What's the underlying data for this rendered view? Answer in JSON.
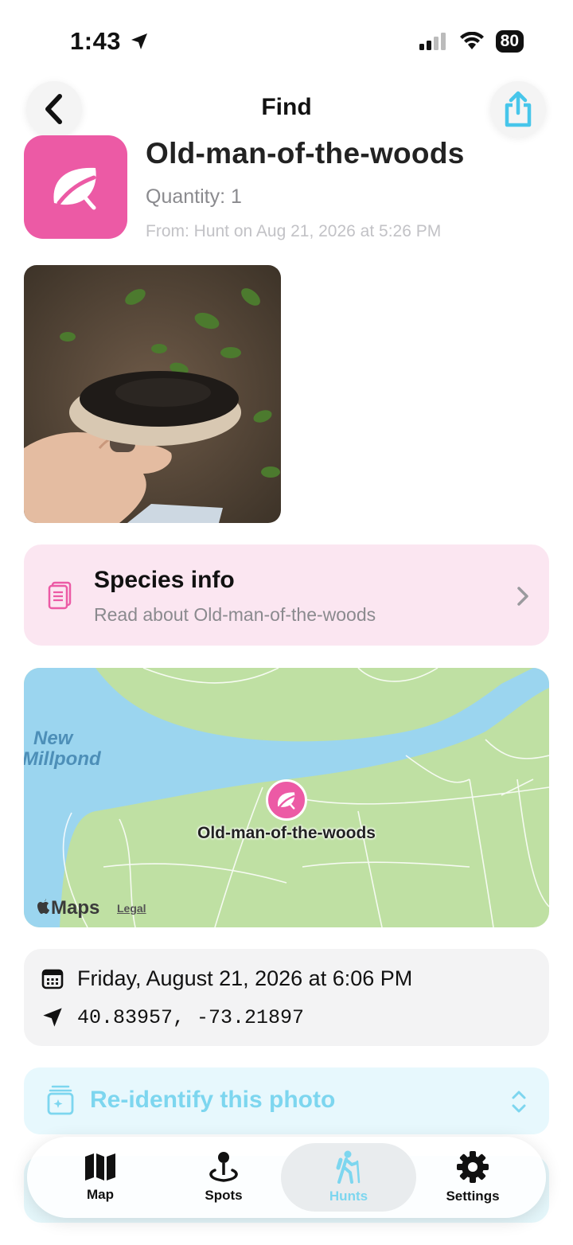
{
  "status_bar": {
    "time": "1:43",
    "battery": "80"
  },
  "nav": {
    "title": "Find"
  },
  "find": {
    "name": "Old-man-of-the-woods",
    "quantity": "Quantity: 1",
    "from": "From: Hunt on Aug 21, 2026 at 5:26 PM"
  },
  "species_card": {
    "title": "Species info",
    "subtitle": "Read about Old-man-of-the-woods"
  },
  "map": {
    "pond_label_1": "New",
    "pond_label_2": "Millpond",
    "pin_label": "Old-man-of-the-woods",
    "attribution": "Maps",
    "legal": "Legal"
  },
  "info": {
    "datetime": "Friday, August 21, 2026 at 6:06 PM",
    "coordinates": "40.83957, -73.21897"
  },
  "reidentify": {
    "label": "Re-identify this photo"
  },
  "tabs": [
    {
      "label": "Map",
      "icon": "map-icon"
    },
    {
      "label": "Spots",
      "icon": "pin-icon"
    },
    {
      "label": "Hunts",
      "icon": "hiker-icon",
      "active": true
    },
    {
      "label": "Settings",
      "icon": "gear-icon"
    }
  ],
  "colors": {
    "accent_pink": "#ec5aa5",
    "accent_cyan": "#55ccec",
    "map_land": "#bfe0a3",
    "map_water": "#9bd5ef"
  }
}
